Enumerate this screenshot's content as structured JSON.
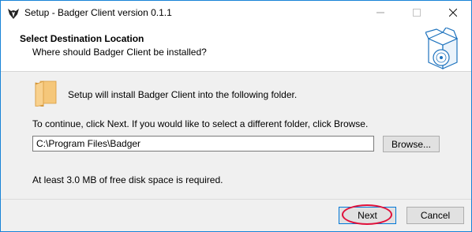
{
  "window": {
    "title": "Setup - Badger Client version 0.1.1",
    "app_icon": "badger-icon",
    "controls": {
      "minimize": "minimize-icon",
      "maximize": "maximize-icon",
      "close": "close-icon"
    }
  },
  "header": {
    "title": "Select Destination Location",
    "subtitle": "Where should Badger Client be installed?",
    "graphic": "installer-box-icon"
  },
  "body": {
    "folder_icon": "folder-icon",
    "install_text": "Setup will install Badger Client into the following folder.",
    "instructions": "To continue, click Next. If you would like to select a different folder, click Browse.",
    "path_value": "C:\\Program Files\\Badger",
    "browse_label": "Browse...",
    "space_text": "At least 3.0 MB of free disk space is required."
  },
  "footer": {
    "next_label": "Next",
    "cancel_label": "Cancel"
  },
  "colors": {
    "accent": "#0078d7",
    "highlight": "#e0103a",
    "folder": "#f5c77a"
  }
}
